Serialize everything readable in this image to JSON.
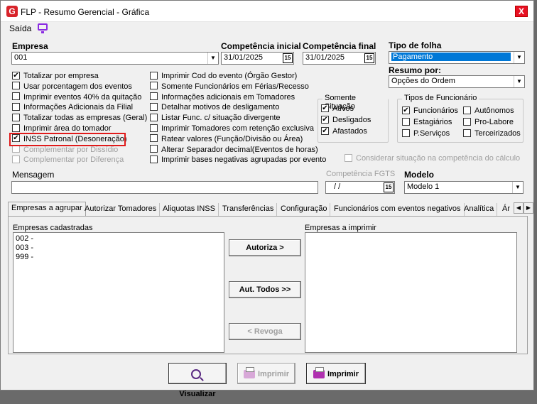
{
  "window": {
    "title": "FLP - Resumo Gerencial - Gráfica",
    "close": "X",
    "app_icon": "G"
  },
  "menu": {
    "saida": "Saída"
  },
  "fields": {
    "empresa_label": "Empresa",
    "empresa_value": "001",
    "competencia_inicial_label": "Competência inicial",
    "competencia_inicial_value": "31/01/2025",
    "competencia_final_label": "Competência final",
    "competencia_final_value": "31/01/2025",
    "calendar_glyph": "15",
    "tipo_folha_label": "Tipo de folha",
    "tipo_folha_value": "Pagamento",
    "resumo_por_label": "Resumo por:",
    "resumo_por_value": "Opções do Ordem",
    "mensagem_label": "Mensagem",
    "mensagem_value": "",
    "competencia_fgts_label": "Competência FGTS",
    "competencia_fgts_value": "/ /",
    "modelo_label": "Modelo",
    "modelo_value": "Modelo 1"
  },
  "left_checks": [
    {
      "label": "Totalizar por empresa",
      "checked": true
    },
    {
      "label": "Usar porcentagem dos eventos",
      "checked": false
    },
    {
      "label": "Imprimir eventos 40% da quitação",
      "checked": false
    },
    {
      "label": "Informações Adicionais da Filial",
      "checked": false
    },
    {
      "label": "Totalizar todas as empresas (Geral)",
      "checked": false
    },
    {
      "label": "Imprimir área do tomador",
      "checked": false
    },
    {
      "label": "INSS Patronal (Desoneração)",
      "checked": true
    },
    {
      "label": "Complementar por Dissídio",
      "checked": false,
      "disabled": true
    },
    {
      "label": "Complementar por Diferença",
      "checked": false,
      "disabled": true
    }
  ],
  "mid_checks": [
    {
      "label": "Imprimir Cod do evento (Órgão Gestor)",
      "checked": false
    },
    {
      "label": "Somente Funcionários em Férias/Recesso",
      "checked": false
    },
    {
      "label": "Informações adicionais em Tomadores",
      "checked": false
    },
    {
      "label": "Detalhar motivos de desligamento",
      "checked": false
    },
    {
      "label": "Listar Func. c/ situação divergente",
      "checked": false
    },
    {
      "label": "Imprimir Tomadores com retenção exclusiva",
      "checked": false
    },
    {
      "label": "Ratear valores (Função/Divisão ou Área)",
      "checked": false
    },
    {
      "label": "Alterar Separador decimal(Eventos de horas)",
      "checked": false
    },
    {
      "label": "Imprimir bases negativas agrupadas por evento",
      "checked": false
    }
  ],
  "situacao": {
    "title": "Somente Situação",
    "items": [
      {
        "label": "Ativos",
        "checked": true
      },
      {
        "label": "Desligados",
        "checked": true
      },
      {
        "label": "Afastados",
        "checked": true
      }
    ]
  },
  "tipos_func": {
    "title": "Tipos de Funcionário",
    "items": [
      {
        "label": "Funcionários",
        "checked": true
      },
      {
        "label": "Autônomos",
        "checked": false
      },
      {
        "label": "Estagiários",
        "checked": false
      },
      {
        "label": "Pro-Labore",
        "checked": false
      },
      {
        "label": "P.Serviços",
        "checked": false
      },
      {
        "label": "Terceirizados",
        "checked": false
      }
    ]
  },
  "considerar": {
    "label": "Considerar situação na competência do cálculo",
    "checked": false
  },
  "tabs": [
    "Empresas a agrupar",
    "Autorizar Tomadores",
    "Aliquotas INSS",
    "Transferências",
    "Configuração",
    "Funcionários com eventos negativos",
    "Analítica",
    "Ár"
  ],
  "panel": {
    "cadastradas_label": "Empresas cadastradas",
    "imprimir_label": "Empresas a imprimir",
    "cadastradas": [
      "002 -",
      "003 -",
      "999 -"
    ],
    "autoriza": "Autoriza >",
    "aut_todos": "Aut. Todos >>",
    "revoga": "< Revoga"
  },
  "bottom": {
    "visualizar": "Visualizar",
    "imprimir_disabled": "Imprimir",
    "imprimir": "Imprimir"
  }
}
